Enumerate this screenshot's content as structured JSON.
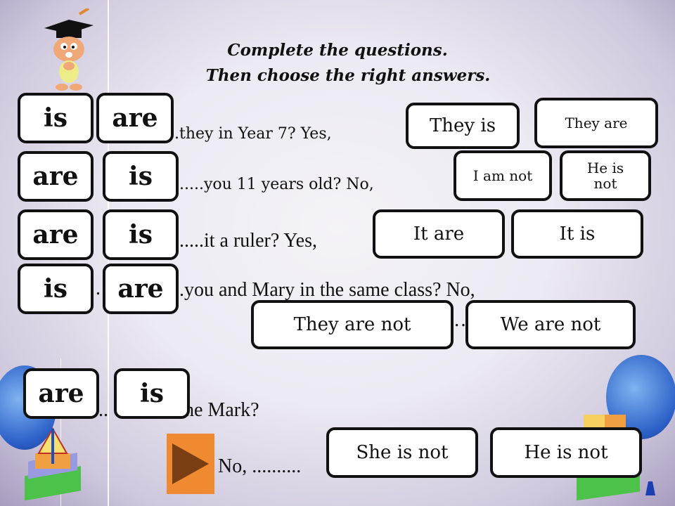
{
  "instructions": {
    "line1": "Complete the questions.",
    "line2": "Then choose the right answers."
  },
  "questions": [
    {
      "options": [
        "is",
        "are"
      ],
      "text": ".they in Year 7? Yes,",
      "answers": [
        "They is",
        "They are"
      ]
    },
    {
      "options": [
        "are",
        "is"
      ],
      "text": ".....you 11 years old? No,",
      "answers": [
        "I am not",
        "He is not"
      ]
    },
    {
      "options": [
        "are",
        "is"
      ],
      "text": ".....it a ruler? Yes,",
      "answers": [
        "It are",
        "It is"
      ]
    },
    {
      "options": [
        "is",
        "are"
      ],
      "text": ".you and Mary in the same class? No,",
      "prefix": ".",
      "answers": [
        "They are not",
        "We are not"
      ],
      "between": "…"
    },
    {
      "options": [
        "are",
        "is"
      ],
      "text": "he Mark?",
      "prefix": "...",
      "answer_prefix": "No, ..........",
      "answers": [
        "She is not",
        "He is not"
      ]
    }
  ],
  "controls": {
    "play_icon": "play-icon"
  },
  "colors": {
    "play_button": "#f08a30",
    "play_triangle": "#7a3e14",
    "card_border": "#111111",
    "background_edge": "#a89cbf"
  }
}
